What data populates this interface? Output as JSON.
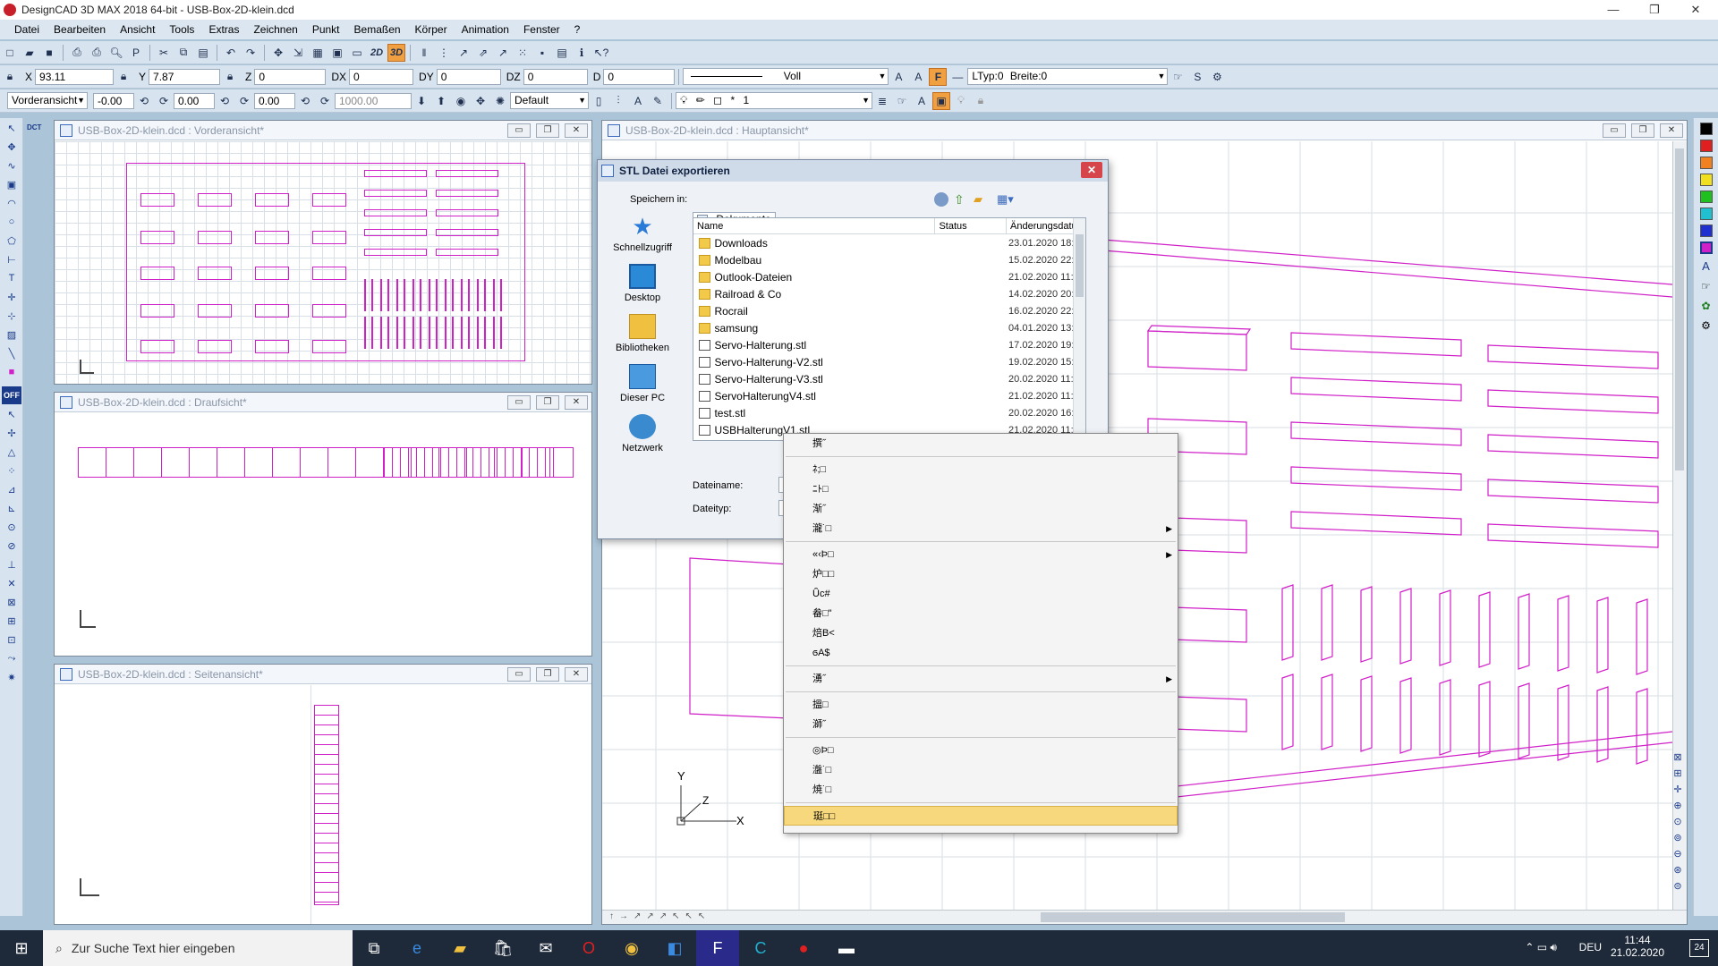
{
  "window": {
    "title": "DesignCAD 3D MAX 2018 64-bit - USB-Box-2D-klein.dcd",
    "minimize": "—",
    "restore": "❐",
    "close": "✕"
  },
  "menu": [
    "Datei",
    "Bearbeiten",
    "Ansicht",
    "Tools",
    "Extras",
    "Zeichnen",
    "Punkt",
    "Bemaßen",
    "Körper",
    "Animation",
    "Fenster",
    "?"
  ],
  "toolbar1": {
    "btn_2d": "2D",
    "btn_3d": "3D"
  },
  "coords": {
    "x_label": "X",
    "x_value": "93.11",
    "y_label": "Y",
    "y_value": "7.87",
    "z_label": "Z",
    "z_value": "0",
    "dx_label": "DX",
    "dx_value": "0",
    "dy_label": "DY",
    "dy_value": "0",
    "dz_label": "DZ",
    "dz_value": "0",
    "d_label": "D",
    "d_value": "0",
    "linestyle": "Voll",
    "ltyp": "LTyp:0",
    "breite": "Breite:0"
  },
  "toolbar3": {
    "view_select": "Vorderansicht",
    "angle1": "-0.00",
    "angle2": "0.00",
    "angle3": "0.00",
    "distance": "1000.00",
    "layer_select": "Default",
    "layer_value": "1"
  },
  "left_tools": {
    "off_label": "OFF",
    "dct_label": "DCT"
  },
  "windows": {
    "front": {
      "title": "USB-Box-2D-klein.dcd : Vorderansicht*"
    },
    "top": {
      "title": "USB-Box-2D-klein.dcd : Draufsicht*"
    },
    "side": {
      "title": "USB-Box-2D-klein.dcd : Seitenansicht*"
    },
    "main": {
      "title": "USB-Box-2D-klein.dcd : Hauptansicht*",
      "axis_x": "X",
      "axis_y": "Y",
      "axis_z": "Z"
    }
  },
  "dialog": {
    "title": "STL Datei exportieren",
    "save_in_label": "Speichern in:",
    "save_in_value": "Dokumente",
    "places": [
      "Schnellzugriff",
      "Desktop",
      "Bibliotheken",
      "Dieser PC",
      "Netzwerk"
    ],
    "columns": {
      "name": "Name",
      "status": "Status",
      "date": "Änderungsdatum"
    },
    "files": [
      {
        "name": "Downloads",
        "type": "folder",
        "date": "23.01.2020 18:"
      },
      {
        "name": "Modelbau",
        "type": "folder",
        "date": "15.02.2020 22:"
      },
      {
        "name": "Outlook-Dateien",
        "type": "folder",
        "date": "21.02.2020 11:"
      },
      {
        "name": "Railroad & Co",
        "type": "folder",
        "date": "14.02.2020 20:"
      },
      {
        "name": "Rocrail",
        "type": "folder",
        "date": "16.02.2020 22:"
      },
      {
        "name": "samsung",
        "type": "folder",
        "date": "04.01.2020 13:"
      },
      {
        "name": "Servo-Halterung.stl",
        "type": "stl",
        "date": "17.02.2020 19:"
      },
      {
        "name": "Servo-Halterung-V2.stl",
        "type": "stl",
        "date": "19.02.2020 15:"
      },
      {
        "name": "Servo-Halterung-V3.stl",
        "type": "stl",
        "date": "20.02.2020 11:"
      },
      {
        "name": "ServoHalterungV4.stl",
        "type": "stl",
        "date": "21.02.2020 11:"
      },
      {
        "name": "test.stl",
        "type": "stl",
        "date": "20.02.2020 16:"
      },
      {
        "name": "USBHalterungV1.stl",
        "type": "stl",
        "date": "21.02.2020 11:"
      }
    ],
    "filename_label": "Dateiname:",
    "filetype_label": "Dateityp:"
  },
  "context_menu": {
    "groups": [
      [
        {
          "label": "撰˝",
          "sub": false
        }
      ],
      [
        {
          "label": "ﾈ;□",
          "sub": false
        },
        {
          "label": "ﾆﾄ□",
          "sub": false
        },
        {
          "label": "渐˝",
          "sub": false
        },
        {
          "label": "瀧˙□",
          "sub": true
        }
      ],
      [
        {
          "label": "«‹Þ□",
          "sub": true
        },
        {
          "label": "炉□□",
          "sub": false
        },
        {
          "label": "Ǖc#",
          "sub": false
        },
        {
          "label": "畚□\"",
          "sub": false
        },
        {
          "label": "焙B<",
          "sub": false
        },
        {
          "label": "ϭA$",
          "sub": false
        }
      ],
      [
        {
          "label": "湧˝",
          "sub": true
        }
      ],
      [
        {
          "label": "搵□",
          "sub": false
        },
        {
          "label": "溮˝",
          "sub": false
        }
      ],
      [
        {
          "label": "◎Þ□",
          "sub": false
        },
        {
          "label": "瀊˙□",
          "sub": false
        },
        {
          "label": "焼˙□",
          "sub": false
        }
      ],
      [
        {
          "label": "珽□□",
          "sub": false,
          "highlight": true
        }
      ]
    ]
  },
  "taskbar": {
    "search_placeholder": "Zur Suche Text hier eingeben",
    "language": "DEU",
    "time": "11:44",
    "date": "21.02.2020",
    "notifications": "24"
  }
}
